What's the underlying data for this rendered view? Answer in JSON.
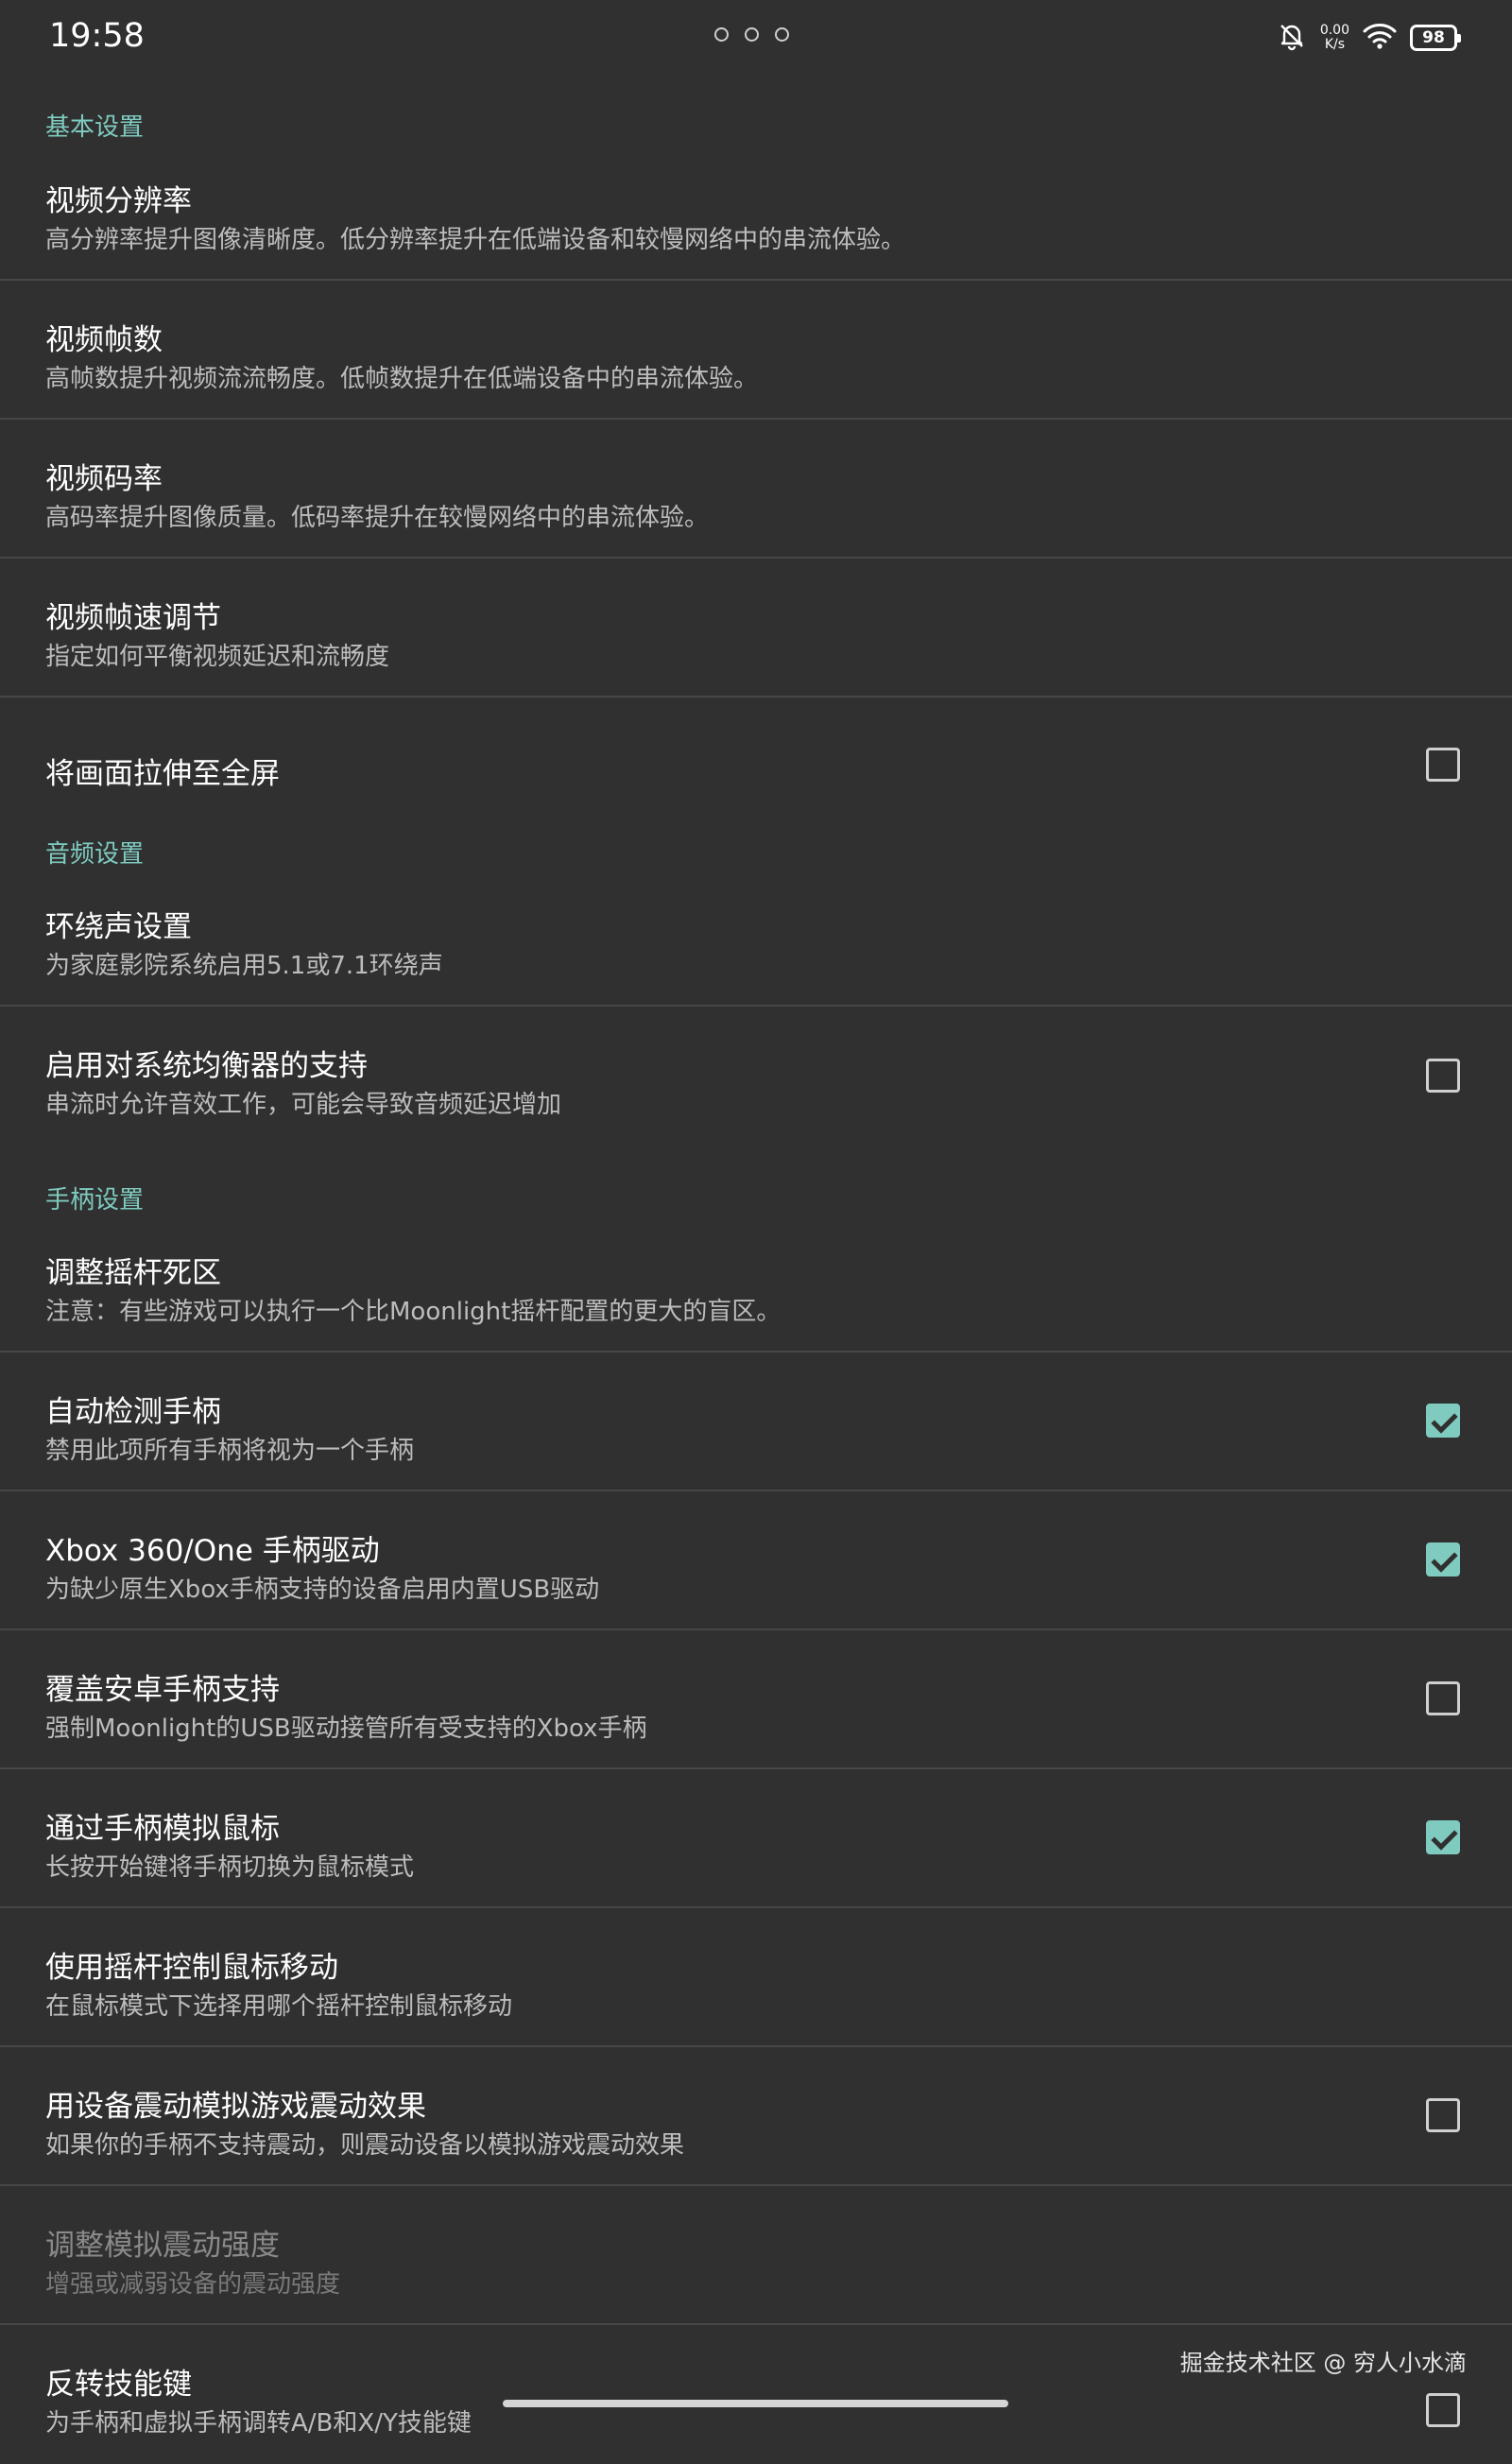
{
  "status_bar": {
    "time": "19:58",
    "net_speed_value": "0.00",
    "net_speed_unit": "K/s",
    "battery": "98"
  },
  "sections": {
    "video": {
      "label": "基本设置",
      "resolution": {
        "title": "视频分辨率",
        "summary": "高分辨率提升图像清晰度。低分辨率提升在低端设备和较慢网络中的串流体验。"
      },
      "fps": {
        "title": "视频帧数",
        "summary": "高帧数提升视频流流畅度。低帧数提升在低端设备中的串流体验。"
      },
      "bitrate": {
        "title": "视频码率",
        "summary": "高码率提升图像质量。低码率提升在较慢网络中的串流体验。"
      },
      "frame_pacing": {
        "title": "视频帧速调节",
        "summary": "指定如何平衡视频延迟和流畅度"
      },
      "stretch": {
        "title": "将画面拉伸至全屏",
        "checked": false
      }
    },
    "audio": {
      "label": "音频设置",
      "surround": {
        "title": "环绕声设置",
        "summary": "为家庭影院系统启用5.1或7.1环绕声"
      },
      "equalizer": {
        "title": "启用对系统均衡器的支持",
        "summary": "串流时允许音效工作，可能会导致音频延迟增加",
        "checked": false
      }
    },
    "gamepad": {
      "label": "手柄设置",
      "deadzone": {
        "title": "调整摇杆死区",
        "summary": "注意：有些游戏可以执行一个比Moonlight摇杆配置的更大的盲区。"
      },
      "autodetect": {
        "title": "自动检测手柄",
        "summary": "禁用此项所有手柄将视为一个手柄",
        "checked": true
      },
      "xbox_driver": {
        "title": "Xbox 360/One 手柄驱动",
        "summary": "为缺少原生Xbox手柄支持的设备启用内置USB驱动",
        "checked": true
      },
      "override": {
        "title": "覆盖安卓手柄支持",
        "summary": "强制Moonlight的USB驱动接管所有受支持的Xbox手柄",
        "checked": false
      },
      "mouse_emulation": {
        "title": "通过手柄模拟鼠标",
        "summary": "长按开始键将手柄切换为鼠标模式",
        "checked": true
      },
      "stick_mouse": {
        "title": "使用摇杆控制鼠标移动",
        "summary": "在鼠标模式下选择用哪个摇杆控制鼠标移动"
      },
      "vibrate": {
        "title": "用设备震动模拟游戏震动效果",
        "summary": "如果你的手柄不支持震动，则震动设备以模拟游戏震动效果",
        "checked": false
      },
      "vibrate_strength": {
        "title": "调整模拟震动强度",
        "summary": "增强或减弱设备的震动强度"
      },
      "flip_face": {
        "title": "反转技能键",
        "summary": "为手柄和虚拟手柄调转A/B和X/Y技能键",
        "checked": false
      }
    }
  },
  "watermark": "掘金技术社区 @ 穷人小水滴"
}
